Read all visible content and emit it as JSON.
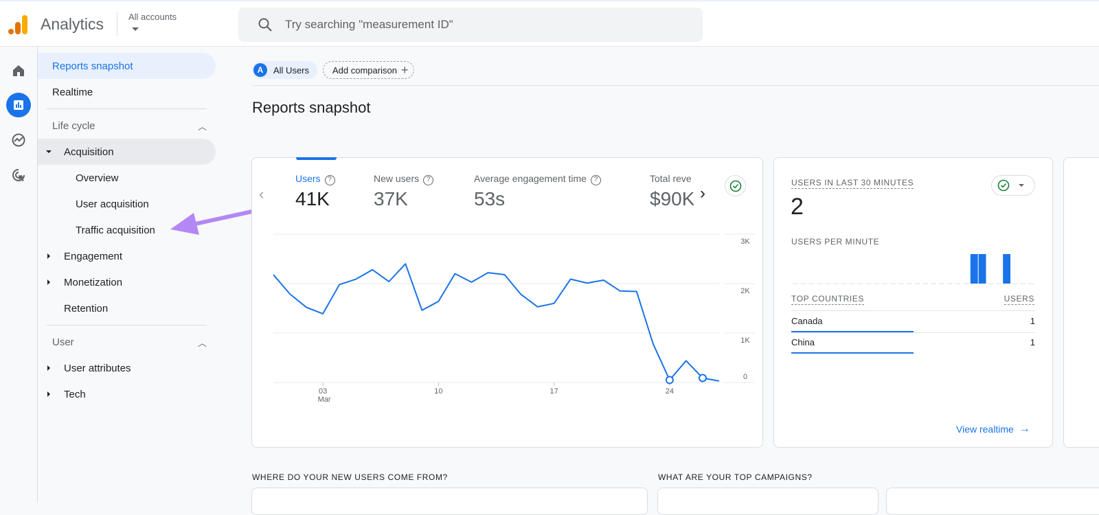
{
  "header": {
    "app_title": "Analytics",
    "account_selector": "All accounts",
    "search_placeholder": "Try searching \"measurement ID\""
  },
  "rail": {
    "icons": [
      "home-icon",
      "reports-icon",
      "explore-icon",
      "advertising-icon"
    ],
    "active": "reports-icon"
  },
  "sidebar": {
    "reports_snapshot": "Reports snapshot",
    "realtime": "Realtime",
    "lifecycle_heading": "Life cycle",
    "acquisition": "Acquisition",
    "acquisition_children": [
      "Overview",
      "User acquisition",
      "Traffic acquisition"
    ],
    "engagement": "Engagement",
    "monetization": "Monetization",
    "retention": "Retention",
    "user_heading": "User",
    "user_attributes": "User attributes",
    "tech": "Tech"
  },
  "comparison": {
    "segment_badge": "A",
    "segment": "All Users",
    "add_comparison": "Add comparison"
  },
  "page_title": "Reports snapshot",
  "metrics": [
    {
      "label": "Users",
      "value": "41K",
      "active": true
    },
    {
      "label": "New users",
      "value": "37K"
    },
    {
      "label": "Average engagement time",
      "value": "53s"
    },
    {
      "label": "Total reve",
      "value": "$90K"
    }
  ],
  "chart_data": {
    "type": "line",
    "x": [
      "Feb 29",
      "Mar 1",
      "Mar 2",
      "Mar 3",
      "Mar 4",
      "Mar 5",
      "Mar 6",
      "Mar 7",
      "Mar 8",
      "Mar 9",
      "Mar 10",
      "Mar 11",
      "Mar 12",
      "Mar 13",
      "Mar 14",
      "Mar 15",
      "Mar 16",
      "Mar 17",
      "Mar 18",
      "Mar 19",
      "Mar 20",
      "Mar 21",
      "Mar 22",
      "Mar 23",
      "Mar 24",
      "Mar 25",
      "Mar 26",
      "Mar 27"
    ],
    "series": [
      {
        "values": [
          2180,
          1790,
          1520,
          1390,
          1980,
          2090,
          2280,
          2040,
          2400,
          1460,
          1640,
          2200,
          2030,
          2220,
          2180,
          1780,
          1530,
          1600,
          2090,
          2010,
          2070,
          1850,
          1840,
          780,
          50,
          440,
          90,
          30
        ]
      }
    ],
    "open_markers": [
      "Mar 24",
      "Mar 26"
    ],
    "ylim": [
      0,
      3000
    ],
    "yticks": [
      "0",
      "1K",
      "2K",
      "3K"
    ],
    "xticks": [
      {
        "label": "03",
        "sub": "Mar",
        "date": "Mar 3"
      },
      {
        "label": "10",
        "date": "Mar 10"
      },
      {
        "label": "17",
        "date": "Mar 17"
      },
      {
        "label": "24",
        "date": "Mar 24"
      }
    ],
    "grid": true,
    "color": "#1a73e8"
  },
  "realtime": {
    "title": "USERS IN LAST 30 MINUTES",
    "value": "2",
    "per_minute_title": "USERS PER MINUTE",
    "per_minute": [
      0,
      0,
      0,
      0,
      0,
      0,
      0,
      0,
      0,
      0,
      0,
      0,
      0,
      0,
      0,
      0,
      0,
      0,
      0,
      0,
      0,
      0,
      1,
      1,
      0,
      0,
      1,
      0,
      0,
      0
    ],
    "countries_header": "TOP COUNTRIES",
    "users_header": "USERS",
    "countries": [
      {
        "name": "Canada",
        "users": "1",
        "share": 0.5
      },
      {
        "name": "China",
        "users": "1",
        "share": 0.5
      }
    ],
    "view_realtime": "View realtime"
  },
  "bottom": {
    "new_users_heading": "WHERE DO YOUR NEW USERS COME FROM?",
    "campaigns_heading": "WHAT ARE YOUR TOP CAMPAIGNS?"
  },
  "colors": {
    "accent": "#1a73e8",
    "annotation_arrow": "#b388f5",
    "check": "#188038"
  }
}
